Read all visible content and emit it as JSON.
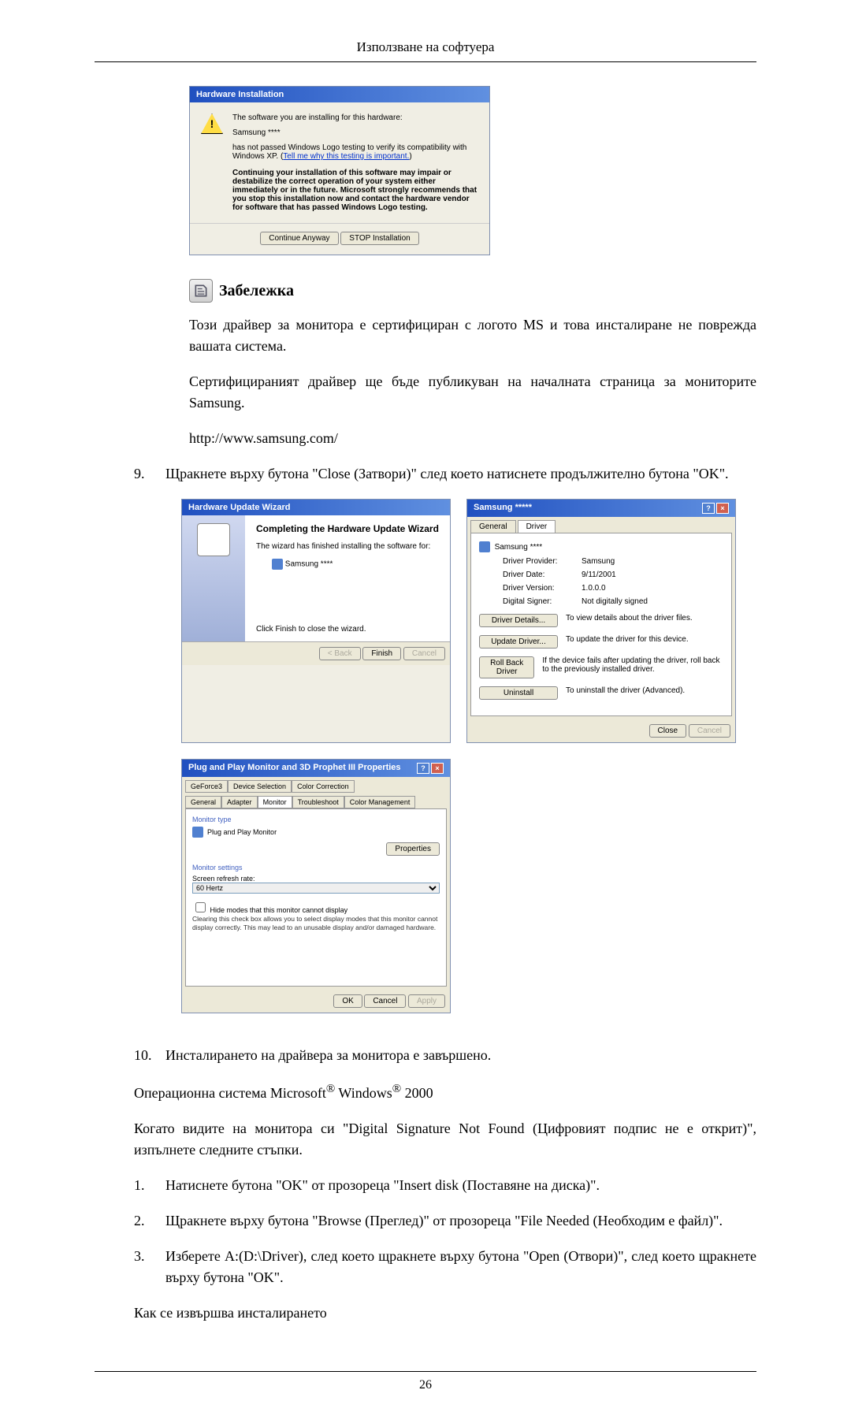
{
  "header": {
    "title": "Използване на софтуера"
  },
  "hw_install": {
    "title": "Hardware Installation",
    "line1": "The software you are installing for this hardware:",
    "device": "Samsung ****",
    "line2a": "has not passed Windows Logo testing to verify its compatibility with Windows XP. (",
    "link": "Tell me why this testing is important.",
    "line2b": ")",
    "bold": "Continuing your installation of this software may impair or destabilize the correct operation of your system either immediately or in the future. Microsoft strongly recommends that you stop this installation now and contact the hardware vendor for software that has passed Windows Logo testing.",
    "continue_btn": "Continue Anyway",
    "stop_btn": "STOP Installation"
  },
  "note": {
    "title": "Забележка",
    "p1": "Този драйвер за монитора е сертифициран с логото MS и това инсталиране не поврежда вашата система.",
    "p2": "Сертифицираният драйвер ще бъде публикуван на началната страница за мониторите Samsung.",
    "url": "http://www.samsung.com/"
  },
  "step9": {
    "num": "9.",
    "text": "Щракнете върху бутона \"Close (Затвори)\" след което натиснете продължително бутона \"OK\"."
  },
  "wizard": {
    "title": "Hardware Update Wizard",
    "heading": "Completing the Hardware Update Wizard",
    "line1": "The wizard has finished installing the software for:",
    "device": "Samsung ****",
    "hint": "Click Finish to close the wizard.",
    "back": "< Back",
    "finish": "Finish",
    "cancel": "Cancel"
  },
  "drv_props": {
    "title": "Samsung *****",
    "tab_general": "General",
    "tab_driver": "Driver",
    "device": "Samsung ****",
    "rows": {
      "provider_l": "Driver Provider:",
      "provider_v": "Samsung",
      "date_l": "Driver Date:",
      "date_v": "9/11/2001",
      "version_l": "Driver Version:",
      "version_v": "1.0.0.0",
      "signer_l": "Digital Signer:",
      "signer_v": "Not digitally signed"
    },
    "btns": {
      "details": "Driver Details...",
      "details_desc": "To view details about the driver files.",
      "update": "Update Driver...",
      "update_desc": "To update the driver for this device.",
      "rollback": "Roll Back Driver",
      "rollback_desc": "If the device fails after updating the driver, roll back to the previously installed driver.",
      "uninstall": "Uninstall",
      "uninstall_desc": "To uninstall the driver (Advanced)."
    },
    "close": "Close",
    "cancel": "Cancel"
  },
  "mon_props": {
    "title": "Plug and Play Monitor and 3D Prophet III Properties",
    "tabs": {
      "geforce": "GeForce3",
      "devsel": "Device Selection",
      "colorcorr": "Color Correction",
      "general": "General",
      "adapter": "Adapter",
      "monitor": "Monitor",
      "troubleshoot": "Troubleshoot",
      "colormgmt": "Color Management"
    },
    "monitor_type_l": "Monitor type",
    "monitor_type_v": "Plug and Play Monitor",
    "properties_btn": "Properties",
    "settings_l": "Monitor settings",
    "refresh_l": "Screen refresh rate:",
    "refresh_v": "60 Hertz",
    "hide_check": "Hide modes that this monitor cannot display",
    "hide_desc": "Clearing this check box allows you to select display modes that this monitor cannot display correctly. This may lead to an unusable display and/or damaged hardware.",
    "ok": "OK",
    "cancel": "Cancel",
    "apply": "Apply"
  },
  "step10": {
    "num": "10.",
    "text": "Инсталирането на драйвера за монитора е завършено."
  },
  "os_line": {
    "prefix": "Операционна система Microsoft",
    "mid": " Windows",
    "suffix": " 2000"
  },
  "dig_sig": "Когато видите на монитора си \"Digital Signature Not Found (Цифровият подпис не е открит)\", изпълнете следните стъпки.",
  "s1": {
    "num": "1.",
    "text": "Натиснете бутона \"OK\" от прозореца \"Insert disk (Поставяне на диска)\"."
  },
  "s2": {
    "num": "2.",
    "text": "Щракнете върху бутона \"Browse (Преглед)\" от прозореца \"File Needed (Необходим е файл)\"."
  },
  "s3": {
    "num": "3.",
    "text": "Изберете A:(D:\\Driver), след което щракнете върху бутона \"Open (Отвори)\", след което щракнете върху бутона \"OK\"."
  },
  "install_how": "Как се извършва инсталирането",
  "page_num": "26"
}
